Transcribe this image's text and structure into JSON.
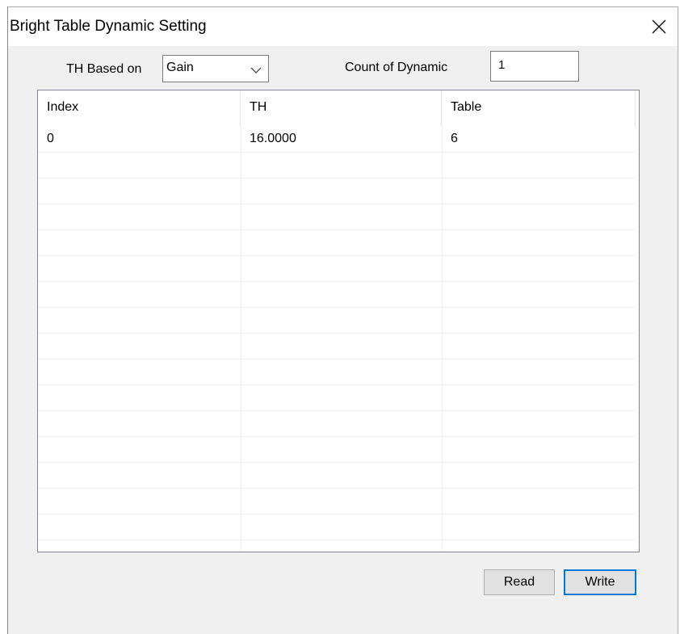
{
  "window": {
    "title": "Bright Table Dynamic Setting",
    "close_icon": "close-icon"
  },
  "controls": {
    "th_based_label": "TH Based on",
    "th_based_value": "Gain",
    "count_label": "Count of Dynamic",
    "count_value": "1"
  },
  "table": {
    "columns": [
      "Index",
      "TH",
      "Table"
    ],
    "rows": [
      [
        "0",
        "16.0000",
        "6"
      ],
      [
        "",
        "",
        ""
      ],
      [
        "",
        "",
        ""
      ],
      [
        "",
        "",
        ""
      ],
      [
        "",
        "",
        ""
      ],
      [
        "",
        "",
        ""
      ],
      [
        "",
        "",
        ""
      ],
      [
        "",
        "",
        ""
      ],
      [
        "",
        "",
        ""
      ],
      [
        "",
        "",
        ""
      ],
      [
        "",
        "",
        ""
      ],
      [
        "",
        "",
        ""
      ],
      [
        "",
        "",
        ""
      ],
      [
        "",
        "",
        ""
      ],
      [
        "",
        "",
        ""
      ],
      [
        "",
        "",
        ""
      ]
    ]
  },
  "buttons": {
    "read_label": "Read",
    "write_label": "Write"
  },
  "colors": {
    "accent": "#0078d7",
    "dialog_bg": "#f0f0f0"
  }
}
